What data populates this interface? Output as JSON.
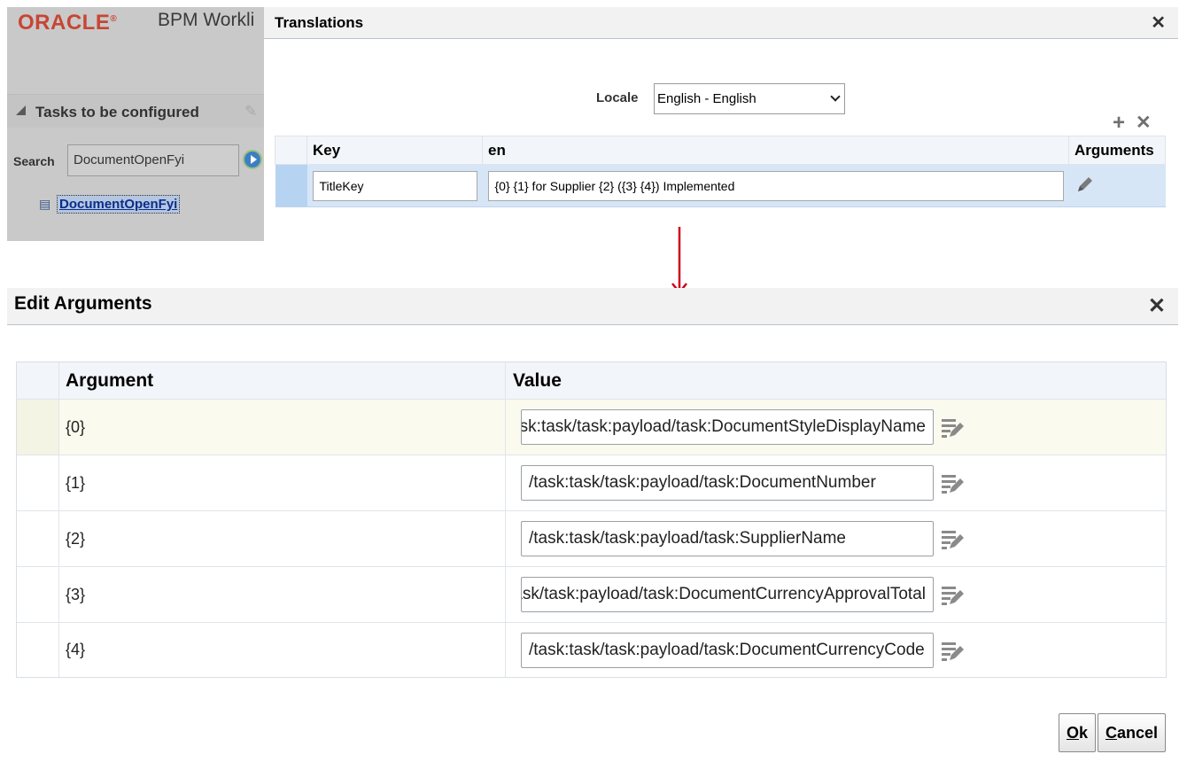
{
  "background": {
    "logo_text": "ORACLE",
    "logo_mark": "®",
    "app_title": "BPM Workli",
    "panel_title": "Tasks to be configured",
    "search_label": "Search",
    "search_value": "DocumentOpenFyi",
    "tree_item": "DocumentOpenFyi"
  },
  "translations": {
    "title": "Translations",
    "locale_label": "Locale",
    "locale_value": "English - English",
    "add_glyph": "+",
    "delete_glyph": "✕",
    "close_glyph": "✕",
    "columns": {
      "key": "Key",
      "locale": "en",
      "arguments": "Arguments"
    },
    "row": {
      "key": "TitleKey",
      "value": "{0} {1} for Supplier {2} ({3} {4}) Implemented"
    }
  },
  "edit_arguments": {
    "title": "Edit Arguments",
    "close_glyph": "✕",
    "columns": {
      "argument": "Argument",
      "value": "Value"
    },
    "rows": [
      {
        "argument": "{0}",
        "value": "/task:task/task:payload/task:DocumentStyleDisplayName"
      },
      {
        "argument": "{1}",
        "value": "/task:task/task:payload/task:DocumentNumber"
      },
      {
        "argument": "{2}",
        "value": "/task:task/task:payload/task:SupplierName"
      },
      {
        "argument": "{3}",
        "value": "/task:task/task:payload/task:DocumentCurrencyApprovalTotal"
      },
      {
        "argument": "{4}",
        "value": "/task:task/task:payload/task:DocumentCurrencyCode"
      }
    ],
    "ok": {
      "accel": "O",
      "rest": "k"
    },
    "cancel": {
      "accel": "C",
      "rest": "ancel"
    }
  },
  "colors": {
    "arrow": "#d0021b",
    "selection": "#b7d3f2",
    "row_highlight": "#fafaee"
  },
  "icons": [
    "pencil-icon",
    "edit-expression-icon",
    "plus-icon",
    "delete-icon",
    "close-icon",
    "dropdown-chevron-icon",
    "go-icon",
    "task-icon"
  ]
}
